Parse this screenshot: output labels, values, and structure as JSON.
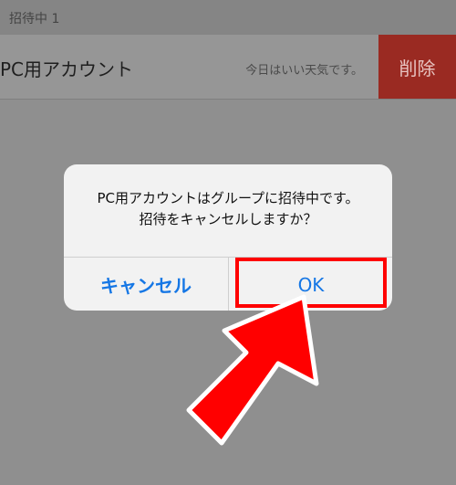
{
  "section": {
    "header": "招待中 1"
  },
  "row": {
    "name": "PC用アカウント",
    "status": "今日はいい天気です。",
    "delete_label": "削除"
  },
  "alert": {
    "line1": "PC用アカウントはグループに招待中です。",
    "line2": "招待をキャンセルしますか？",
    "cancel_label": "キャンセル",
    "ok_label": "OK"
  },
  "colors": {
    "accent": "#1677e5",
    "delete_bg": "#9a2a22",
    "highlight": "#ff0000",
    "arrow": "#ff0000"
  },
  "icons": {
    "pointer": "arrow-icon"
  }
}
